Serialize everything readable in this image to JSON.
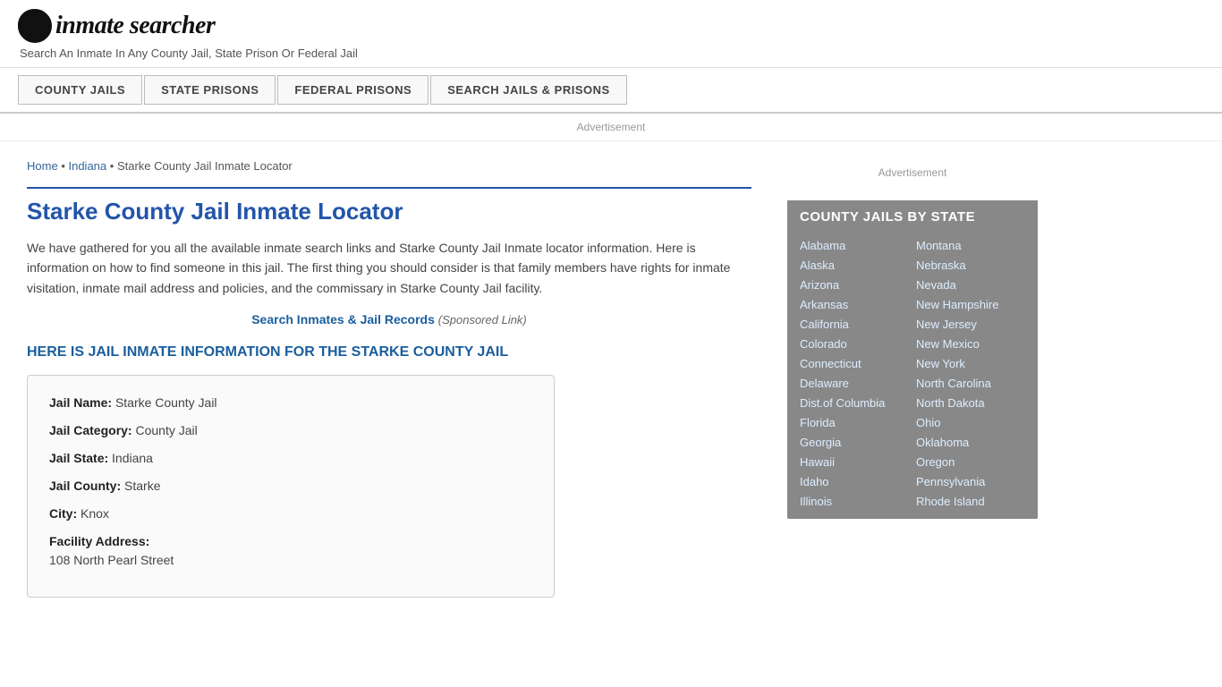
{
  "header": {
    "logo_icon": "🔍",
    "logo_text": "inmate searcher",
    "tagline": "Search An Inmate In Any County Jail, State Prison Or Federal Jail"
  },
  "nav": {
    "buttons": [
      {
        "id": "county-jails",
        "label": "COUNTY JAILS"
      },
      {
        "id": "state-prisons",
        "label": "STATE PRISONS"
      },
      {
        "id": "federal-prisons",
        "label": "FEDERAL PRISONS"
      },
      {
        "id": "search-jails",
        "label": "SEARCH JAILS & PRISONS"
      }
    ]
  },
  "breadcrumb": {
    "home": "Home",
    "state": "Indiana",
    "current": "Starke County Jail Inmate Locator"
  },
  "main": {
    "page_title": "Starke County Jail Inmate Locator",
    "description": "We have gathered for you all the available inmate search links and Starke County Jail Inmate locator information. Here is information on how to find someone in this jail. The first thing you should consider is that family members have rights for inmate visitation, inmate mail address and policies, and the commissary in Starke County Jail facility.",
    "sponsored_link_text": "Search Inmates & Jail Records",
    "sponsored_label": "(Sponsored Link)",
    "jail_info_heading": "HERE IS JAIL INMATE INFORMATION FOR THE STARKE COUNTY JAIL",
    "jail_details": {
      "name_label": "Jail Name:",
      "name_value": "Starke County Jail",
      "category_label": "Jail Category:",
      "category_value": "County Jail",
      "state_label": "Jail State:",
      "state_value": "Indiana",
      "county_label": "Jail County:",
      "county_value": "Starke",
      "city_label": "City:",
      "city_value": "Knox",
      "address_label": "Facility Address:",
      "address_value": "108 North Pearl Street"
    }
  },
  "sidebar": {
    "ad_label": "Advertisement",
    "state_box_title": "COUNTY JAILS BY STATE",
    "states_left": [
      "Alabama",
      "Alaska",
      "Arizona",
      "Arkansas",
      "California",
      "Colorado",
      "Connecticut",
      "Delaware",
      "Dist.of Columbia",
      "Florida",
      "Georgia",
      "Hawaii",
      "Idaho",
      "Illinois"
    ],
    "states_right": [
      "Montana",
      "Nebraska",
      "Nevada",
      "New Hampshire",
      "New Jersey",
      "New Mexico",
      "New York",
      "North Carolina",
      "North Dakota",
      "Ohio",
      "Oklahoma",
      "Oregon",
      "Pennsylvania",
      "Rhode Island"
    ]
  }
}
